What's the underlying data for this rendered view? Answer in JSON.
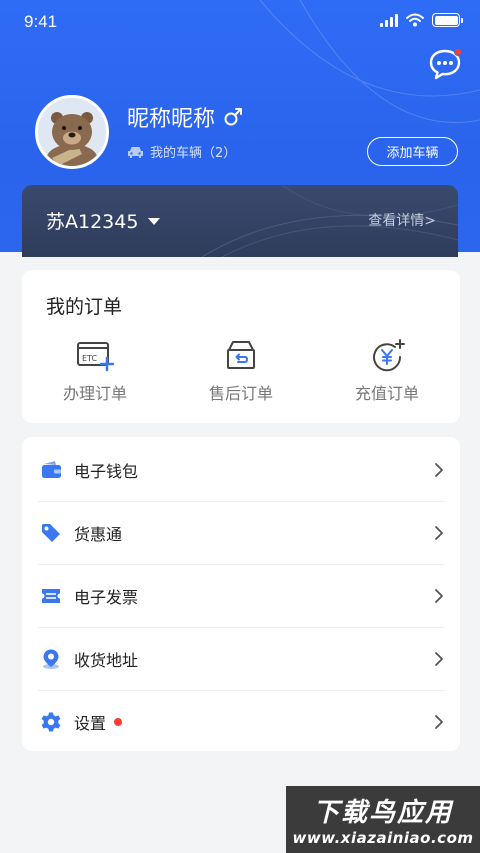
{
  "status_bar": {
    "time": "9:41"
  },
  "profile": {
    "nickname": "昵称昵称",
    "vehicles_text": "我的车辆（2）",
    "add_vehicle_label": "添加车辆"
  },
  "plate_card": {
    "plate_number": "苏A12345",
    "detail_label": "查看详情>"
  },
  "orders": {
    "title": "我的订单",
    "items": [
      {
        "label": "办理订单",
        "icon": "etc-card-plus-icon"
      },
      {
        "label": "售后订单",
        "icon": "return-box-icon"
      },
      {
        "label": "充值订单",
        "icon": "yuan-recharge-icon"
      }
    ]
  },
  "menu": {
    "items": [
      {
        "label": "电子钱包",
        "icon": "wallet-icon"
      },
      {
        "label": "货惠通",
        "icon": "tag-icon"
      },
      {
        "label": "电子发票",
        "icon": "ticket-icon"
      },
      {
        "label": "收货地址",
        "icon": "location-icon"
      },
      {
        "label": "设置",
        "icon": "gear-icon",
        "has_badge": true
      }
    ]
  },
  "watermark": {
    "title": "下载鸟应用",
    "url": "www.xiazainiao.com"
  },
  "colors": {
    "primary": "#2f6cf6",
    "accent_icon": "#3a78f2",
    "plate_card": "#34446a",
    "badge": "#ff3b30"
  }
}
